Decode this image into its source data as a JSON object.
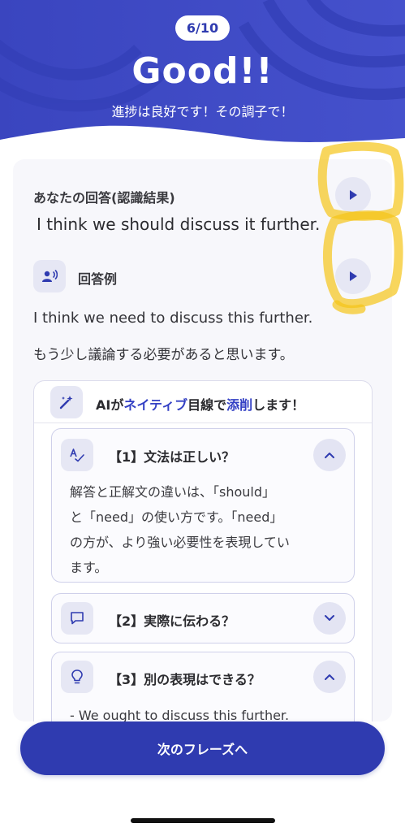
{
  "header": {
    "progress": "6/10",
    "title": "Good!!",
    "subtitle": "進捗は良好です！その調子で！"
  },
  "answer": {
    "label": "あなたの回答(認識結果)",
    "text": "I think we should discuss it further."
  },
  "example": {
    "label": "回答例",
    "text": "I think we need to discuss this further.",
    "translation": "もう少し議論する必要があると思います。"
  },
  "ai_feedback": {
    "title_parts": [
      "AIが",
      "ネイティブ",
      "目線で",
      "添削",
      "します！"
    ],
    "sections": [
      {
        "title": "【1】文法は正しい？",
        "expanded": true,
        "body_lines": [
          "解答と正解文の違いは、「should」",
          "と「need」の使い方です。「need」",
          "の方が、より強い必要性を表現してい",
          "ます。"
        ]
      },
      {
        "title": "【2】実際に伝わる？",
        "expanded": false,
        "body_lines": []
      },
      {
        "title": "【3】別の表現はできる？",
        "expanded": true,
        "body_lines": [
          "- We ought to discuss this further."
        ]
      }
    ]
  },
  "next_button": "次のフレーズへ",
  "colors": {
    "brand": "#2f3bb0",
    "header_bg": "#3d49c4",
    "accent_text": "#3340c4",
    "icon_bg": "#e6e7f4",
    "highlight": "#f5c518"
  },
  "icons": [
    "play-icon",
    "speaker-person-icon",
    "magic-wand-icon",
    "spellcheck-icon",
    "chat-bubble-icon",
    "lightbulb-icon",
    "chevron-up-icon",
    "chevron-down-icon"
  ]
}
